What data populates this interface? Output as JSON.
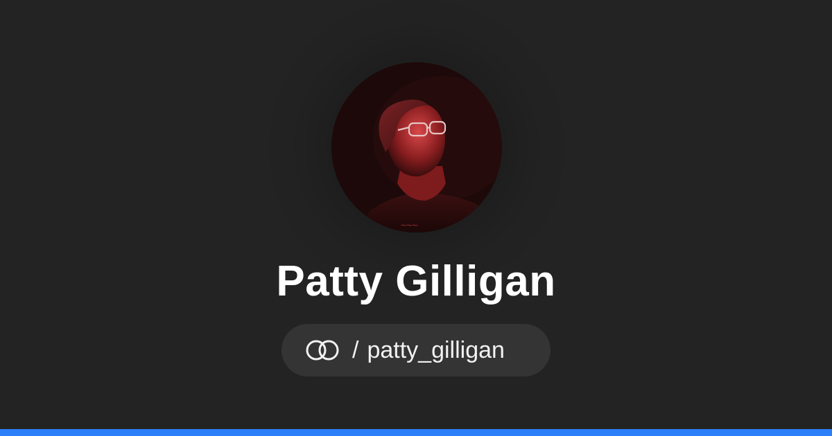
{
  "profile": {
    "name": "Patty Gilligan",
    "handle_separator": "/",
    "handle": "patty_gilligan"
  },
  "avatar": {
    "description_icon": "profile-photo"
  },
  "brand": {
    "logo_icon": "linked-rings-icon",
    "accent_color": "#2d7ff9",
    "background_color": "#232323",
    "pill_color": "#343434"
  }
}
